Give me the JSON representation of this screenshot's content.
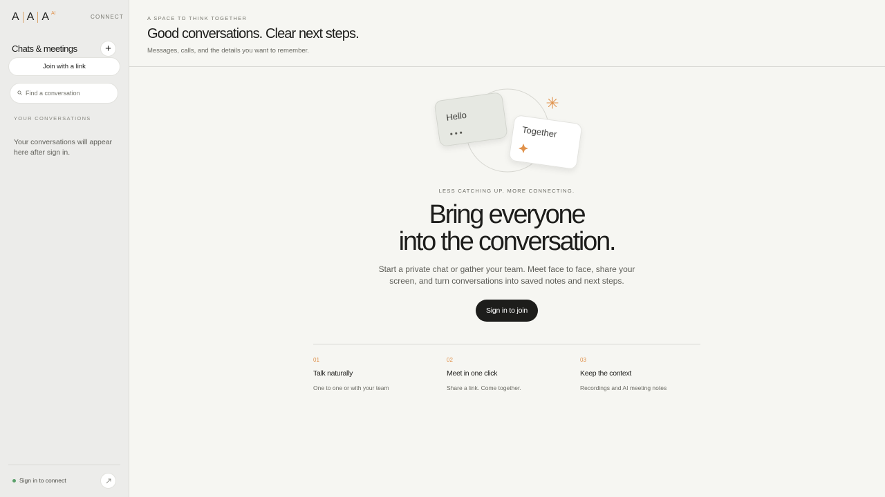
{
  "sidebar": {
    "logo": {
      "letters": [
        "A",
        "A",
        "A"
      ],
      "badge": "AI"
    },
    "connect_label": "CONNECT",
    "chats_title": "Chats & meetings",
    "add_label": "+",
    "join_label": "Join with a link",
    "search": {
      "placeholder": "Find a conversation",
      "value": ""
    },
    "section_label": "YOUR CONVERSATIONS",
    "empty_note": "Your conversations will appear here after sign in.",
    "status_label": "Sign in to connect"
  },
  "header": {
    "eyebrow": "A SPACE TO THINK TOGETHER",
    "title": "Good conversations. Clear next steps.",
    "subtitle": "Messages, calls, and the details you want to remember."
  },
  "hero": {
    "card_left": "Hello",
    "card_right": "Together",
    "tagline": "LESS CATCHING UP. MORE CONNECTING.",
    "title_line1": "Bring everyone",
    "title_line2": "into the conversation.",
    "description": "Start a private chat or gather your team. Meet face to face, share your screen, and turn conversations into saved notes and next steps.",
    "cta_label": "Sign in to join"
  },
  "features": [
    {
      "num": "01",
      "title": "Talk naturally",
      "desc": "One to one or with your team"
    },
    {
      "num": "02",
      "title": "Meet in one click",
      "desc": "Share a link. Come together."
    },
    {
      "num": "03",
      "title": "Keep the context",
      "desc": "Recordings and AI meeting notes"
    }
  ],
  "colors": {
    "accent": "#e0914a",
    "status_online": "#5aa06a",
    "cta_bg": "#1d1d1b",
    "sidebar_bg": "#ececea",
    "page_bg": "#f6f6f2"
  },
  "icons": {
    "add": "plus-icon",
    "search": "search-icon",
    "expand": "expand-arrow-icon",
    "sparkle": "sparkle-icon",
    "asterisk": "asterisk-icon"
  }
}
